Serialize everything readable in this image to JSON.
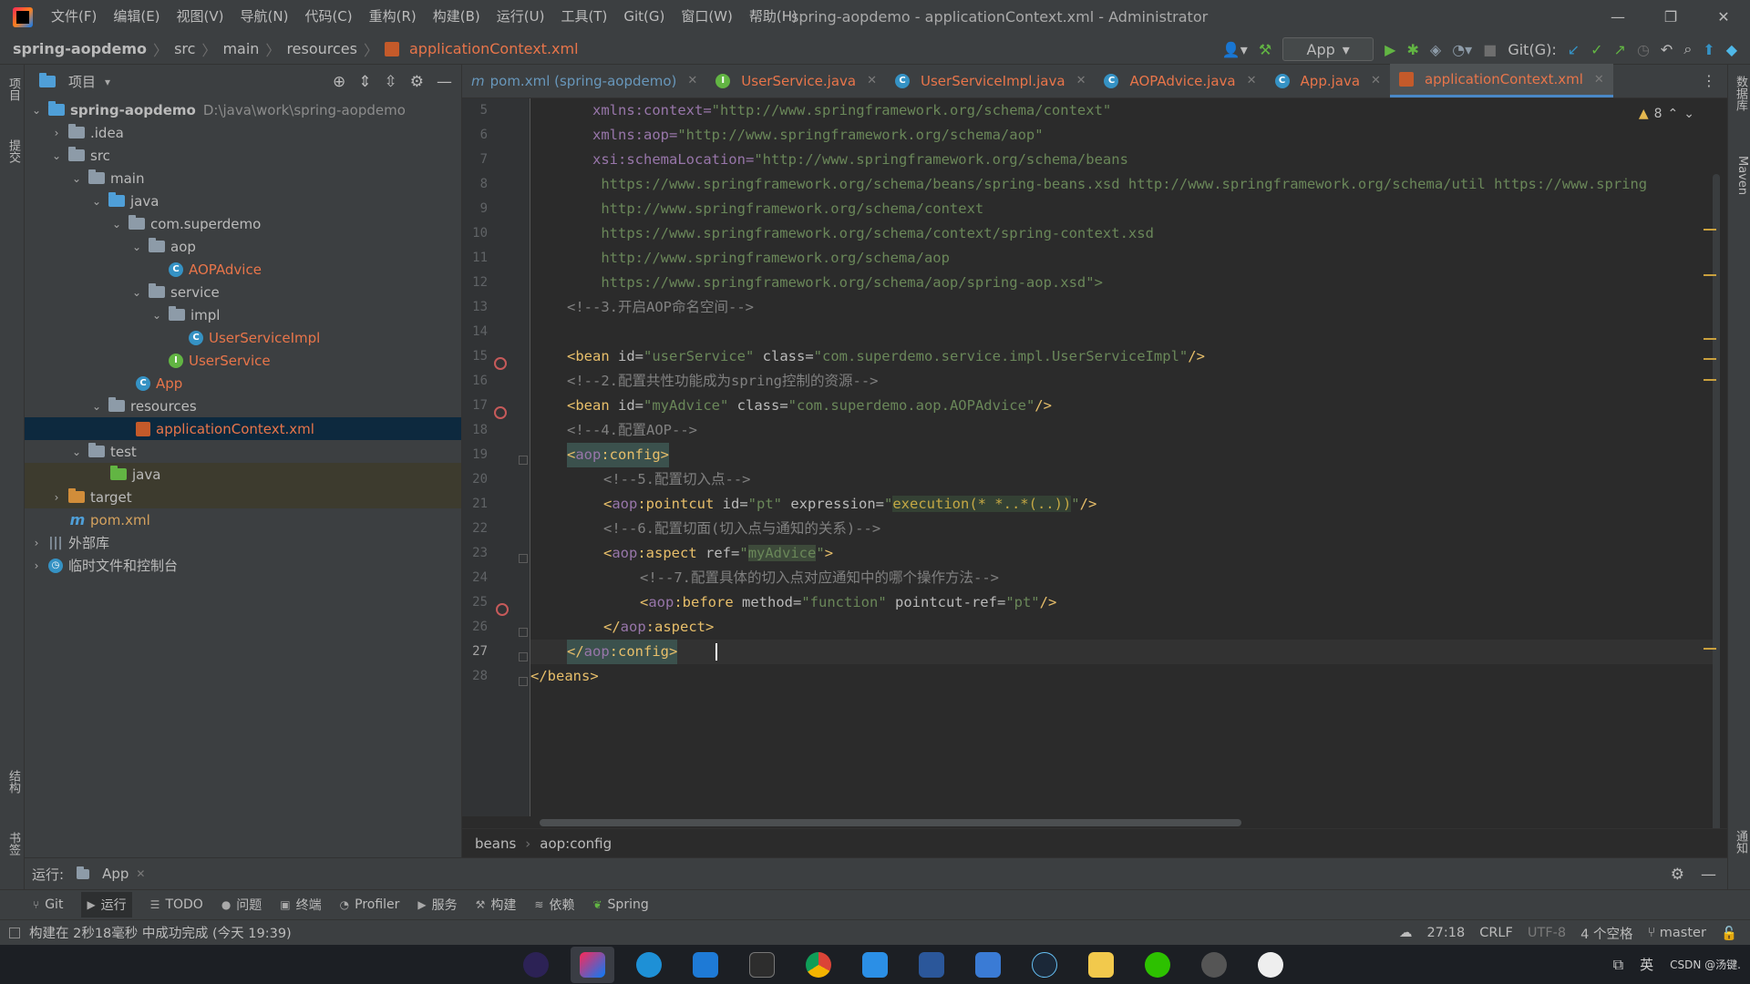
{
  "titlebar": {
    "menu": [
      "文件(F)",
      "编辑(E)",
      "视图(V)",
      "导航(N)",
      "代码(C)",
      "重构(R)",
      "构建(B)",
      "运行(U)",
      "工具(T)",
      "Git(G)",
      "窗口(W)",
      "帮助(H)"
    ],
    "window_title": "spring-aopdemo - applicationContext.xml - Administrator"
  },
  "navbar": {
    "crumbs": [
      "spring-aopdemo",
      "src",
      "main",
      "resources"
    ],
    "file": "applicationContext.xml",
    "run_config": "App",
    "git_label": "Git(G):"
  },
  "left_strip": {
    "project": "项目",
    "commit": "提交",
    "structure": "结构",
    "bookmarks": "书签"
  },
  "right_strip": {
    "database": "数据库",
    "maven": "Maven",
    "notifications": "通知"
  },
  "project": {
    "title": "项目",
    "tree": [
      {
        "label": "spring-aopdemo",
        "path": "D:\\java\\work\\spring-aopdemo"
      },
      {
        "label": ".idea"
      },
      {
        "label": "src"
      },
      {
        "label": "main"
      },
      {
        "label": "java"
      },
      {
        "label": "com.superdemo"
      },
      {
        "label": "aop"
      },
      {
        "label": "AOPAdvice"
      },
      {
        "label": "service"
      },
      {
        "label": "impl"
      },
      {
        "label": "UserServiceImpl"
      },
      {
        "label": "UserService"
      },
      {
        "label": "App"
      },
      {
        "label": "resources"
      },
      {
        "label": "applicationContext.xml"
      },
      {
        "label": "test"
      },
      {
        "label": "java"
      },
      {
        "label": "target"
      },
      {
        "label": "pom.xml"
      },
      {
        "label": "外部库"
      },
      {
        "label": "临时文件和控制台"
      }
    ]
  },
  "tabs": [
    {
      "label": "pom.xml (spring-aopdemo)"
    },
    {
      "label": "UserService.java"
    },
    {
      "label": "UserServiceImpl.java"
    },
    {
      "label": "AOPAdvice.java"
    },
    {
      "label": "App.java"
    },
    {
      "label": "applicationContext.xml"
    }
  ],
  "editor": {
    "warnings": "8",
    "line_numbers": [
      "5",
      "6",
      "7",
      "8",
      "9",
      "10",
      "11",
      "12",
      "13",
      "14",
      "15",
      "16",
      "17",
      "18",
      "19",
      "20",
      "21",
      "22",
      "23",
      "24",
      "25",
      "26",
      "27",
      "28"
    ],
    "current_line": "27",
    "crumbs": [
      "beans",
      "aop:config"
    ],
    "code": {
      "l5a": "xmlns:context=",
      "l5b": "\"http://www.springframework.org/schema/context\"",
      "l6a": "xmlns:aop=",
      "l6b": "\"http://www.springframework.org/schema/aop\"",
      "l7a": "xsi:schemaLocation=",
      "l7b": "\"http://www.springframework.org/schema/beans",
      "l8": " https://www.springframework.org/schema/beans/spring-beans.xsd http://www.springframework.org/schema/util https://www.spring",
      "l9": " http://www.springframework.org/schema/context",
      "l10": " https://www.springframework.org/schema/context/spring-context.xsd",
      "l11": " http://www.springframework.org/schema/aop",
      "l12": " https://www.springframework.org/schema/aop/spring-aop.xsd\">",
      "l13": "<!--3.开启AOP命名空间-->",
      "l15a": "<bean",
      "l15b": " id=",
      "l15c": "\"userService\"",
      "l15d": " class=",
      "l15e": "\"com.superdemo.service.impl.UserServiceImpl\"",
      "l15f": "/>",
      "l16": "<!--2.配置共性功能成为spring控制的资源-->",
      "l17a": "<bean",
      "l17b": " id=",
      "l17c": "\"myAdvice\"",
      "l17d": " class=",
      "l17e": "\"com.superdemo.aop.AOPAdvice\"",
      "l17f": "/>",
      "l18": "<!--4.配置AOP-->",
      "l19a": "<",
      "l19b": "aop",
      "l19c": ":config>",
      "l20": "<!--5.配置切入点-->",
      "l21a": "<",
      "l21b": "aop",
      "l21c": ":pointcut",
      "l21d": " id=",
      "l21e": "\"pt\"",
      "l21f": " expression=",
      "l21g": "\"",
      "l21h": "execution(* *..*(..))",
      "l21i": "\"",
      "l21j": "/>",
      "l22": "<!--6.配置切面(切入点与通知的关系)-->",
      "l23a": "<",
      "l23b": "aop",
      "l23c": ":aspect",
      "l23d": " ref=",
      "l23e": "\"",
      "l23f": "myAdvice",
      "l23g": "\"",
      "l23h": ">",
      "l24": "<!--7.配置具体的切入点对应通知中的哪个操作方法-->",
      "l25a": "<",
      "l25b": "aop",
      "l25c": ":before",
      "l25d": " method=",
      "l25e": "\"function\"",
      "l25f": " pointcut-ref=",
      "l25g": "\"pt\"",
      "l25h": "/>",
      "l26a": "</",
      "l26b": "aop",
      "l26c": ":aspect>",
      "l27a": "</",
      "l27b": "aop",
      "l27c": ":config>",
      "l28": "</beans>"
    }
  },
  "runbar": {
    "label": "运行:",
    "tab": "App"
  },
  "toolwindows": [
    "Git",
    "运行",
    "TODO",
    "问题",
    "终端",
    "Profiler",
    "服务",
    "构建",
    "依赖",
    "Spring"
  ],
  "status": {
    "message": "构建在 2秒18毫秒 中成功完成 (今天 19:39)",
    "position": "27:18",
    "line_sep": "CRLF",
    "encoding": "UTF-8",
    "indent": "4 个空格",
    "branch": "master"
  },
  "taskbar": {
    "ime": "英",
    "watermark": "CSDN @汤键."
  },
  "colors": {
    "accent": "#4a88c7",
    "selection": "#0d293e",
    "tag": "#e8bf6a",
    "string": "#6a8759",
    "namespace": "#9876aa"
  }
}
